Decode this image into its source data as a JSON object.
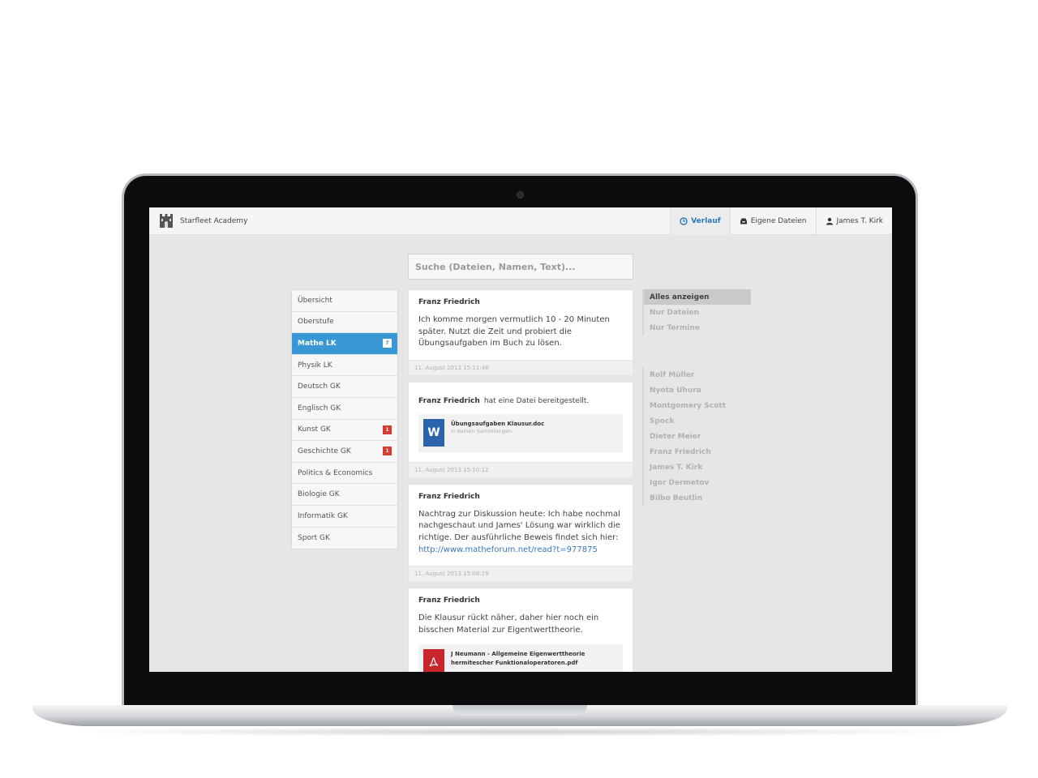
{
  "app": {
    "brand": "Starfleet Academy",
    "nav": [
      {
        "label": "Verlauf",
        "icon": "clock-icon"
      },
      {
        "label": "Eigene Dateien",
        "icon": "inbox-icon"
      },
      {
        "label": "James T. Kirk",
        "icon": "user-icon"
      }
    ]
  },
  "search": {
    "placeholder": "Suche (Dateien, Namen, Text)..."
  },
  "sidebar": {
    "items": [
      {
        "label": "Übersicht",
        "badge": ""
      },
      {
        "label": "Oberstufe",
        "badge": ""
      },
      {
        "label": "Mathe LK",
        "badge": "7",
        "active": true
      },
      {
        "label": "Physik LK",
        "badge": ""
      },
      {
        "label": "Deutsch GK",
        "badge": ""
      },
      {
        "label": "Englisch GK",
        "badge": ""
      },
      {
        "label": "Kunst GK",
        "badge": "1"
      },
      {
        "label": "Geschichte GK",
        "badge": "1"
      },
      {
        "label": "Politics & Economics",
        "badge": ""
      },
      {
        "label": "Biologie GK",
        "badge": ""
      },
      {
        "label": "Informatik GK",
        "badge": ""
      },
      {
        "label": "Sport GK",
        "badge": ""
      }
    ]
  },
  "feed": [
    {
      "author": "Franz Friedrich",
      "text": "Ich komme morgen vermutlich 10 - 20 Minuten später. Nutzt die Zeit und probiert die Übungsaufgaben im Buch zu lösen.",
      "timestamp": "11. August 2013 15:11:48"
    },
    {
      "author": "Franz Friedrich",
      "action": "hat eine Datei bereitgestellt.",
      "file_name": "Übungsaufgaben Klausur.doc",
      "file_sub": "In keinen Sammlungen.",
      "file_icon": "W",
      "timestamp": "11. August 2013 15:10:12"
    },
    {
      "author": "Franz Friedrich",
      "text": "Nachtrag zur Diskussion heute: Ich habe nochmal nachgeschaut und James' Lösung war wirklich die richtige. Der ausführliche Beweis findet sich hier:",
      "link": "http://www.matheforum.net/read?t=977875",
      "timestamp": "11. August 2013 15:08:29"
    },
    {
      "author": "Franz Friedrich",
      "text": "Die Klausur rückt näher, daher hier noch ein bisschen Material zur Eigentwerttheorie.",
      "file_name_line1": "J Neumann - Allgemeine Eigenwerttheorie",
      "file_name_line2": "hermitescher Funktionaloperatoren.pdf"
    }
  ],
  "filters": [
    "Alles anzeigen",
    "Nur Dateien",
    "Nur Termine"
  ],
  "people": [
    "Rolf Müller",
    "Nyota Uhura",
    "Montgomery Scott",
    "Spock",
    "Dieter Meier",
    "Franz Friedrich",
    "James T. Kirk",
    "Igor Dermetov",
    "Bilbo Beutlin"
  ],
  "colors": {
    "accent": "#3a97d6",
    "badge": "#d93a32",
    "link": "#3a77bf"
  }
}
